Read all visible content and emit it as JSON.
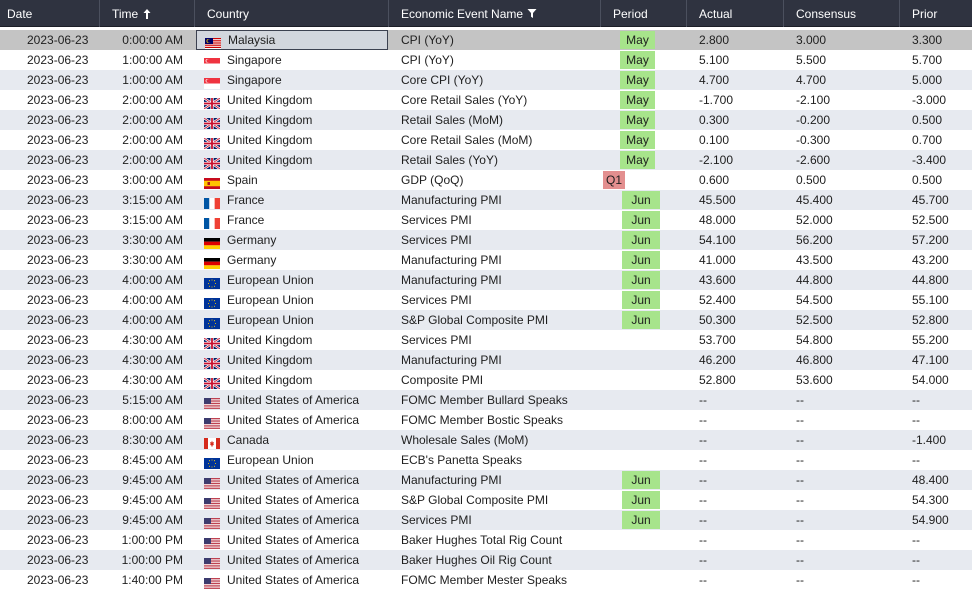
{
  "header": {
    "date": "Date",
    "time": "Time",
    "country": "Country",
    "event": "Economic Event Name",
    "period": "Period",
    "actual": "Actual",
    "consensus": "Consensus",
    "prior": "Prior"
  },
  "colors": {
    "period_may_jun": "#a7e48b",
    "period_q1": "#e38f8f",
    "header_bg": "#2f3340"
  },
  "rows": [
    {
      "date": "2023-06-23",
      "time": "0:00:00 AM",
      "flag": "my",
      "country": "Malaysia",
      "event": "CPI (YoY)",
      "period": "May",
      "actual": "2.800",
      "consensus": "3.000",
      "prior": "3.300",
      "selected": true
    },
    {
      "date": "2023-06-23",
      "time": "1:00:00 AM",
      "flag": "sg",
      "country": "Singapore",
      "event": "CPI (YoY)",
      "period": "May",
      "actual": "5.100",
      "consensus": "5.500",
      "prior": "5.700"
    },
    {
      "date": "2023-06-23",
      "time": "1:00:00 AM",
      "flag": "sg",
      "country": "Singapore",
      "event": "Core CPI (YoY)",
      "period": "May",
      "actual": "4.700",
      "consensus": "4.700",
      "prior": "5.000"
    },
    {
      "date": "2023-06-23",
      "time": "2:00:00 AM",
      "flag": "gb",
      "country": "United Kingdom",
      "event": "Core Retail Sales (YoY)",
      "period": "May",
      "actual": "-1.700",
      "consensus": "-2.100",
      "prior": "-3.000"
    },
    {
      "date": "2023-06-23",
      "time": "2:00:00 AM",
      "flag": "gb",
      "country": "United Kingdom",
      "event": "Retail Sales (MoM)",
      "period": "May",
      "actual": "0.300",
      "consensus": "-0.200",
      "prior": "0.500"
    },
    {
      "date": "2023-06-23",
      "time": "2:00:00 AM",
      "flag": "gb",
      "country": "United Kingdom",
      "event": "Core Retail Sales (MoM)",
      "period": "May",
      "actual": "0.100",
      "consensus": "-0.300",
      "prior": "0.700"
    },
    {
      "date": "2023-06-23",
      "time": "2:00:00 AM",
      "flag": "gb",
      "country": "United Kingdom",
      "event": "Retail Sales (YoY)",
      "period": "May",
      "actual": "-2.100",
      "consensus": "-2.600",
      "prior": "-3.400"
    },
    {
      "date": "2023-06-23",
      "time": "3:00:00 AM",
      "flag": "es",
      "country": "Spain",
      "event": "GDP (QoQ)",
      "period": "Q1",
      "actual": "0.600",
      "consensus": "0.500",
      "prior": "0.500"
    },
    {
      "date": "2023-06-23",
      "time": "3:15:00 AM",
      "flag": "fr",
      "country": "France",
      "event": "Manufacturing PMI",
      "period": "Jun",
      "actual": "45.500",
      "consensus": "45.400",
      "prior": "45.700"
    },
    {
      "date": "2023-06-23",
      "time": "3:15:00 AM",
      "flag": "fr",
      "country": "France",
      "event": "Services PMI",
      "period": "Jun",
      "actual": "48.000",
      "consensus": "52.000",
      "prior": "52.500"
    },
    {
      "date": "2023-06-23",
      "time": "3:30:00 AM",
      "flag": "de",
      "country": "Germany",
      "event": "Services PMI",
      "period": "Jun",
      "actual": "54.100",
      "consensus": "56.200",
      "prior": "57.200"
    },
    {
      "date": "2023-06-23",
      "time": "3:30:00 AM",
      "flag": "de",
      "country": "Germany",
      "event": "Manufacturing PMI",
      "period": "Jun",
      "actual": "41.000",
      "consensus": "43.500",
      "prior": "43.200"
    },
    {
      "date": "2023-06-23",
      "time": "4:00:00 AM",
      "flag": "eu",
      "country": "European Union",
      "event": "Manufacturing PMI",
      "period": "Jun",
      "actual": "43.600",
      "consensus": "44.800",
      "prior": "44.800"
    },
    {
      "date": "2023-06-23",
      "time": "4:00:00 AM",
      "flag": "eu",
      "country": "European Union",
      "event": "Services PMI",
      "period": "Jun",
      "actual": "52.400",
      "consensus": "54.500",
      "prior": "55.100"
    },
    {
      "date": "2023-06-23",
      "time": "4:00:00 AM",
      "flag": "eu",
      "country": "European Union",
      "event": "S&P Global Composite PMI",
      "period": "Jun",
      "actual": "50.300",
      "consensus": "52.500",
      "prior": "52.800"
    },
    {
      "date": "2023-06-23",
      "time": "4:30:00 AM",
      "flag": "gb",
      "country": "United Kingdom",
      "event": "Services PMI",
      "period": "",
      "actual": "53.700",
      "consensus": "54.800",
      "prior": "55.200"
    },
    {
      "date": "2023-06-23",
      "time": "4:30:00 AM",
      "flag": "gb",
      "country": "United Kingdom",
      "event": "Manufacturing PMI",
      "period": "",
      "actual": "46.200",
      "consensus": "46.800",
      "prior": "47.100"
    },
    {
      "date": "2023-06-23",
      "time": "4:30:00 AM",
      "flag": "gb",
      "country": "United Kingdom",
      "event": "Composite PMI",
      "period": "",
      "actual": "52.800",
      "consensus": "53.600",
      "prior": "54.000"
    },
    {
      "date": "2023-06-23",
      "time": "5:15:00 AM",
      "flag": "us",
      "country": "United States of America",
      "event": "FOMC Member Bullard Speaks",
      "period": "",
      "actual": "--",
      "consensus": "--",
      "prior": "--"
    },
    {
      "date": "2023-06-23",
      "time": "8:00:00 AM",
      "flag": "us",
      "country": "United States of America",
      "event": "FOMC Member Bostic Speaks",
      "period": "",
      "actual": "--",
      "consensus": "--",
      "prior": "--"
    },
    {
      "date": "2023-06-23",
      "time": "8:30:00 AM",
      "flag": "ca",
      "country": "Canada",
      "event": "Wholesale Sales (MoM)",
      "period": "",
      "actual": "--",
      "consensus": "--",
      "prior": "-1.400"
    },
    {
      "date": "2023-06-23",
      "time": "8:45:00 AM",
      "flag": "eu",
      "country": "European Union",
      "event": "ECB's Panetta Speaks",
      "period": "",
      "actual": "--",
      "consensus": "--",
      "prior": "--"
    },
    {
      "date": "2023-06-23",
      "time": "9:45:00 AM",
      "flag": "us",
      "country": "United States of America",
      "event": "Manufacturing PMI",
      "period": "Jun",
      "actual": "--",
      "consensus": "--",
      "prior": "48.400"
    },
    {
      "date": "2023-06-23",
      "time": "9:45:00 AM",
      "flag": "us",
      "country": "United States of America",
      "event": "S&P Global Composite PMI",
      "period": "Jun",
      "actual": "--",
      "consensus": "--",
      "prior": "54.300"
    },
    {
      "date": "2023-06-23",
      "time": "9:45:00 AM",
      "flag": "us",
      "country": "United States of America",
      "event": "Services PMI",
      "period": "Jun",
      "actual": "--",
      "consensus": "--",
      "prior": "54.900"
    },
    {
      "date": "2023-06-23",
      "time": "1:00:00 PM",
      "flag": "us",
      "country": "United States of America",
      "event": "Baker Hughes Total Rig Count",
      "period": "",
      "actual": "--",
      "consensus": "--",
      "prior": "--"
    },
    {
      "date": "2023-06-23",
      "time": "1:00:00 PM",
      "flag": "us",
      "country": "United States of America",
      "event": "Baker Hughes Oil Rig Count",
      "period": "",
      "actual": "--",
      "consensus": "--",
      "prior": "--"
    },
    {
      "date": "2023-06-23",
      "time": "1:40:00 PM",
      "flag": "us",
      "country": "United States of America",
      "event": "FOMC Member Mester Speaks",
      "period": "",
      "actual": "--",
      "consensus": "--",
      "prior": "--"
    }
  ]
}
